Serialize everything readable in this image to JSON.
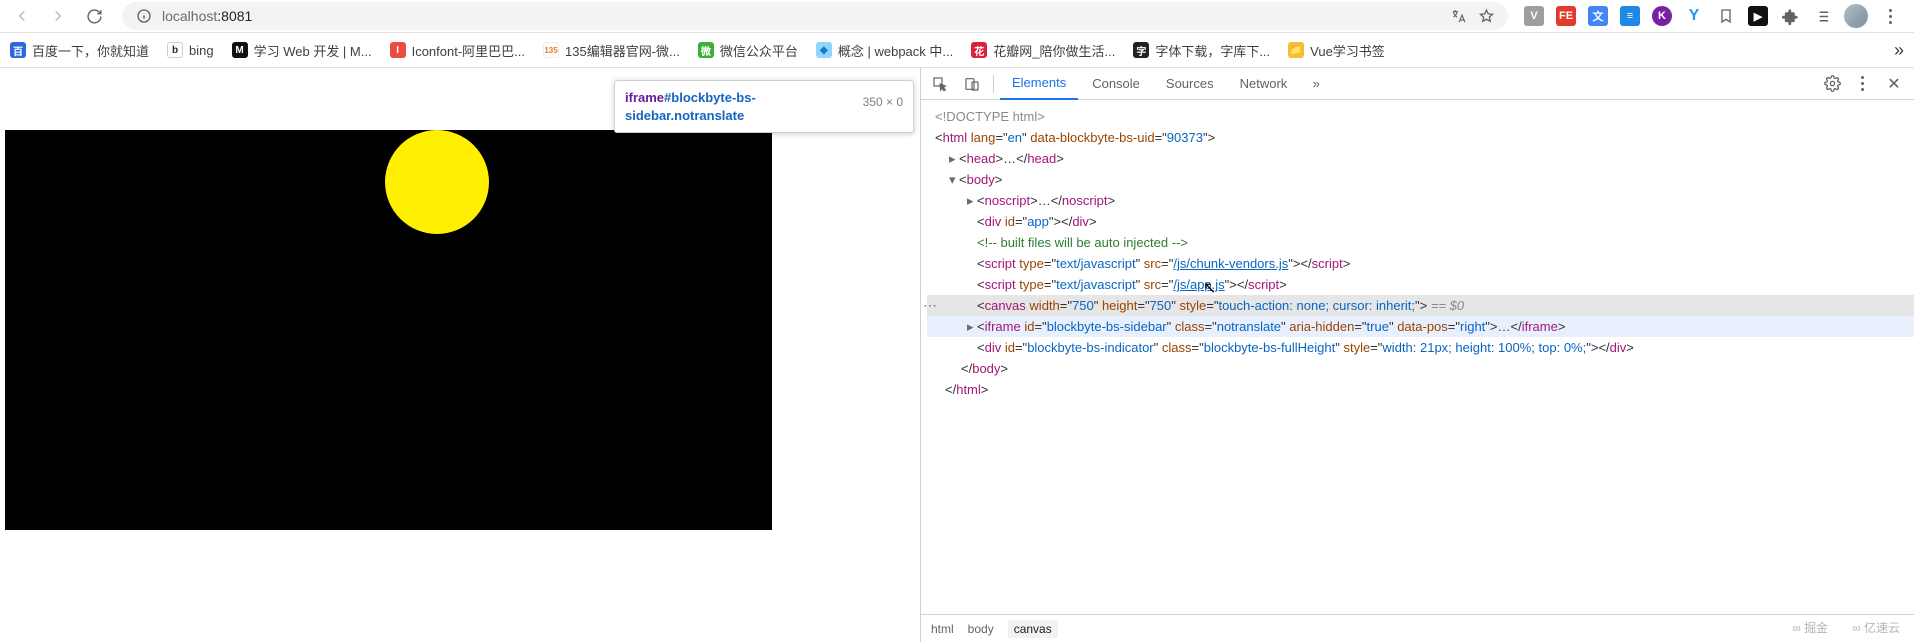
{
  "toolbar": {
    "url_prefix": "localhost",
    "url_port": ":8081"
  },
  "bookmarks": [
    {
      "label": "百度一下，你就知道",
      "icon": "百",
      "bg": "#2b68df"
    },
    {
      "label": "bing",
      "icon": "b",
      "bg": "#2b2b2b"
    },
    {
      "label": "学习 Web 开发 | M...",
      "icon": "",
      "bg": "#111"
    },
    {
      "label": "Iconfont-阿里巴巴...",
      "icon": "",
      "bg": "#e84d3d"
    },
    {
      "label": "135编辑器官网-微...",
      "icon": "135",
      "bg": "#fff"
    },
    {
      "label": "微信公众平台",
      "icon": "",
      "bg": "#3cb034"
    },
    {
      "label": "概念 | webpack 中...",
      "icon": "",
      "bg": "#8ed6fb"
    },
    {
      "label": "花瓣网_陪你做生活...",
      "icon": "",
      "bg": "#d8223c"
    },
    {
      "label": "字体下载，字库下...",
      "icon": "",
      "bg": "#222"
    },
    {
      "label": "Vue学习书签",
      "icon": "",
      "bg": "#f7be2f"
    }
  ],
  "tooltip": {
    "tag": "iframe",
    "idcls": "#blockbyte-bs-sidebar.notranslate",
    "dimensions": "350 × 0"
  },
  "devtools": {
    "tabs": {
      "elements": "Elements",
      "console": "Console",
      "sources": "Sources",
      "network": "Network"
    },
    "dom": {
      "doctype": "<!DOCTYPE html>",
      "html_open": {
        "lang": "en",
        "attr": "data-blockbyte-bs-uid",
        "val": "90373"
      },
      "head": "<head>…</head>",
      "body": "<body>",
      "noscript": "<noscript>…</noscript>",
      "appdiv": {
        "id": "app"
      },
      "comment": "<!-- built files will be auto injected -->",
      "script1_src": "/js/chunk-vendors.js",
      "script2_src": "/js/app.js",
      "canvas": {
        "w": "750",
        "h": "750",
        "style": "touch-action: none; cursor: inherit;"
      },
      "dollar": " == $0",
      "iframe": {
        "id": "blockbyte-bs-sidebar",
        "cls": "notranslate",
        "aria": "true",
        "pos": "right"
      },
      "indicator": {
        "id": "blockbyte-bs-indicator",
        "cls": "blockbyte-bs-fullHeight",
        "style": "width: 21px; height: 100%; top: 0%;"
      },
      "body_close": "</body>",
      "html_close": "</html>"
    },
    "crumbs": {
      "a": "html",
      "b": "body",
      "c": "canvas"
    }
  },
  "watermark": {
    "a": "掘金",
    "b": "亿速云"
  }
}
